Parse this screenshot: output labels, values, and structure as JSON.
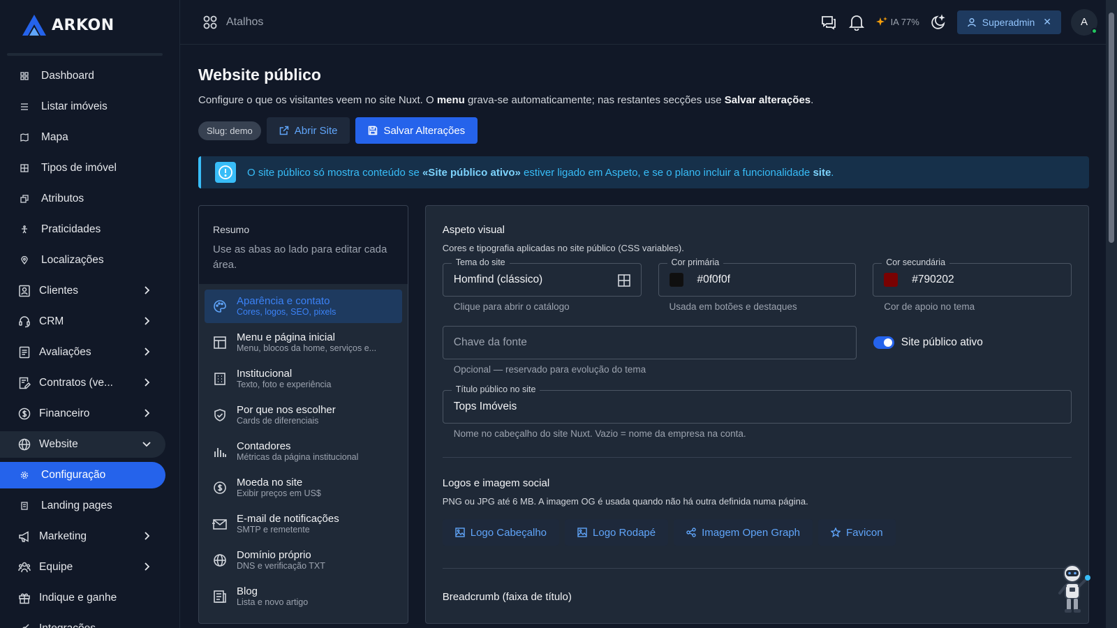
{
  "brand": {
    "name": "ARKON"
  },
  "sidebar": {
    "items": [
      {
        "label": "Dashboard"
      },
      {
        "label": "Listar imóveis"
      },
      {
        "label": "Mapa"
      },
      {
        "label": "Tipos de imóvel"
      },
      {
        "label": "Atributos"
      },
      {
        "label": "Praticidades"
      },
      {
        "label": "Localizações"
      },
      {
        "label": "Clientes"
      },
      {
        "label": "CRM"
      },
      {
        "label": "Avaliações"
      },
      {
        "label": "Contratos (ve..."
      },
      {
        "label": "Financeiro"
      },
      {
        "label": "Website"
      },
      {
        "label": "Configuração"
      },
      {
        "label": "Landing pages"
      },
      {
        "label": "Marketing"
      },
      {
        "label": "Equipe"
      },
      {
        "label": "Indique e ganhe"
      },
      {
        "label": "Integrações"
      }
    ]
  },
  "topbar": {
    "shortcuts_label": "Atalhos",
    "ia_label": "IA 77%",
    "superadmin_label": "Superadmin",
    "avatar_initial": "A"
  },
  "page": {
    "title": "Website público",
    "desc_1": "Configure o que os visitantes veem no site Nuxt. O ",
    "desc_bold_1": "menu",
    "desc_2": " grava-se automaticamente; nas restantes secções use ",
    "desc_bold_2": "Salvar alterações",
    "desc_3": ".",
    "slug": "Slug: demo",
    "open_site": "Abrir Site",
    "save": "Salvar Alterações"
  },
  "info": {
    "text_1": "O site público só mostra conteúdo se ",
    "bold_1": "«Site público ativo»",
    "text_2": " estiver ligado em Aspeto, e se o plano incluir a funcionalidade ",
    "bold_2": "site",
    "text_3": "."
  },
  "summary": {
    "title": "Resumo",
    "text": "Use as abas ao lado para editar cada área."
  },
  "tabs": [
    {
      "label": "Aparência e contato",
      "sub": "Cores, logos, SEO, pixels"
    },
    {
      "label": "Menu e página inicial",
      "sub": "Menu, blocos da home, serviços e..."
    },
    {
      "label": "Institucional",
      "sub": "Texto, foto e experiência"
    },
    {
      "label": "Por que nos escolher",
      "sub": "Cards de diferenciais"
    },
    {
      "label": "Contadores",
      "sub": "Métricas da página institucional"
    },
    {
      "label": "Moeda no site",
      "sub": "Exibir preços em US$"
    },
    {
      "label": "E-mail de notificações",
      "sub": "SMTP e remetente"
    },
    {
      "label": "Domínio próprio",
      "sub": "DNS e verificação TXT"
    },
    {
      "label": "Blog",
      "sub": "Lista e novo artigo"
    }
  ],
  "aspect": {
    "title": "Aspeto visual",
    "desc": "Cores e tipografia aplicadas no site público (CSS variables).",
    "theme": {
      "label": "Tema do site",
      "value": "Homfind (clássico)",
      "hint": "Clique para abrir o catálogo"
    },
    "primary": {
      "label": "Cor primária",
      "value": "#0f0f0f",
      "hint": "Usada em botões e destaques",
      "color": "#0f0f0f"
    },
    "secondary": {
      "label": "Cor secundária",
      "value": "#790202",
      "hint": "Cor de apoio no tema",
      "color": "#790202"
    },
    "font": {
      "placeholder": "Chave da fonte",
      "hint": "Opcional — reservado para evolução do tema"
    },
    "public_toggle": {
      "label": "Site público ativo",
      "on": true
    },
    "public_title": {
      "label": "Título público no site",
      "value": "Tops Imóveis",
      "hint": "Nome no cabeçalho do site Nuxt. Vazio = nome da empresa na conta."
    }
  },
  "logos": {
    "title": "Logos e imagem social",
    "desc": "PNG ou JPG até 6 MB. A imagem OG é usada quando não há outra definida numa página.",
    "buttons": [
      {
        "label": "Logo Cabeçalho",
        "icon": "image-icon"
      },
      {
        "label": "Logo Rodapé",
        "icon": "image-icon"
      },
      {
        "label": "Imagem Open Graph",
        "icon": "share-icon"
      },
      {
        "label": "Favicon",
        "icon": "star-icon"
      }
    ]
  },
  "breadcrumb": {
    "title": "Breadcrumb (faixa de título)"
  },
  "colors": {
    "accent": "#2563eb",
    "info": "#38bdf8",
    "sidebar_bg": "#111827",
    "card_bg": "#1f2937"
  }
}
